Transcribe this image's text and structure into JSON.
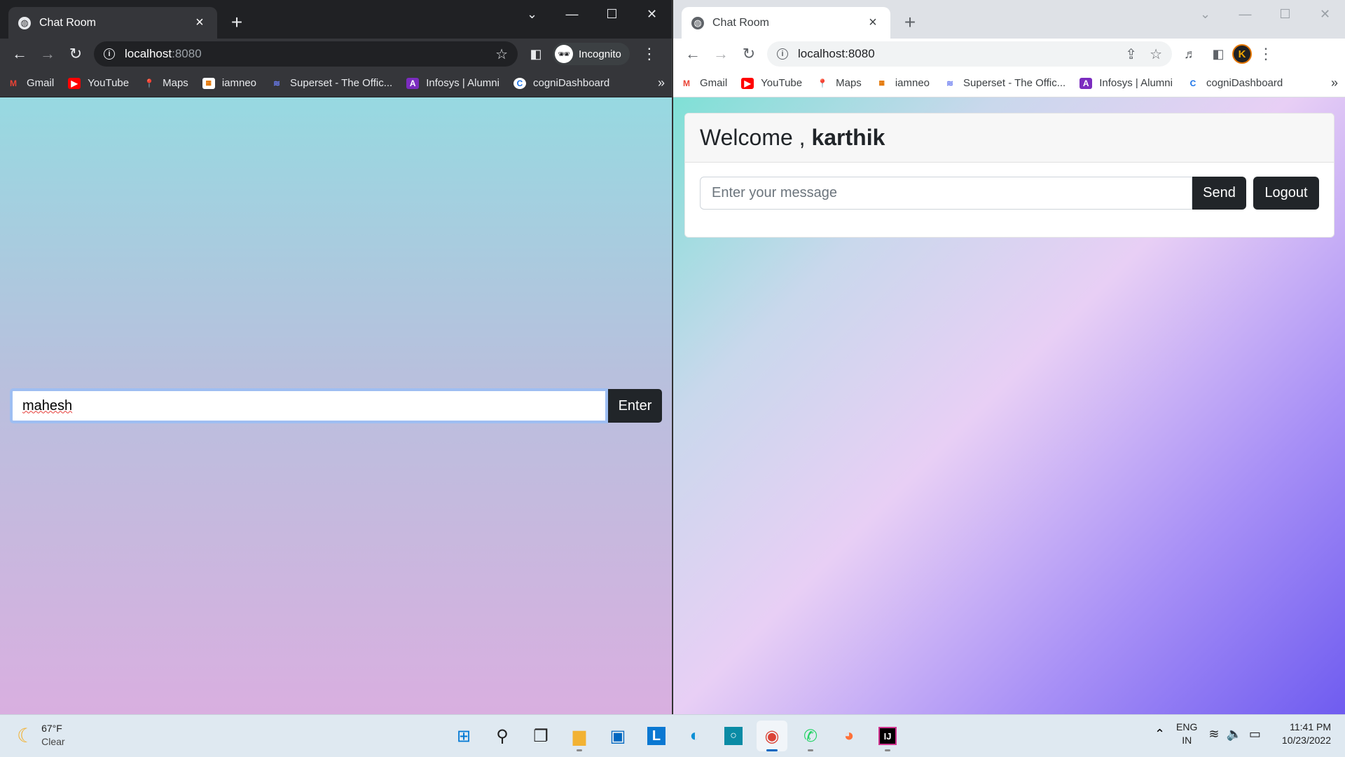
{
  "tab_title": "Chat Room",
  "address": {
    "host": "localhost",
    "port": ":8080"
  },
  "incognito_label": "Incognito",
  "profile_initial": "K",
  "bookmarks": [
    {
      "label": "Gmail",
      "icon": "gmail-icon"
    },
    {
      "label": "YouTube",
      "icon": "youtube-icon"
    },
    {
      "label": "Maps",
      "icon": "maps-icon"
    },
    {
      "label": "iamneo",
      "icon": "iamneo-icon"
    },
    {
      "label": "Superset - The Offic...",
      "icon": "superset-icon"
    },
    {
      "label": "Infosys | Alumni",
      "icon": "infosys-icon"
    },
    {
      "label": "cogniDashboard",
      "icon": "cognidashboard-icon"
    }
  ],
  "login": {
    "name_value": "mahesh",
    "enter_label": "Enter"
  },
  "chat": {
    "welcome_prefix": "Welcome ,",
    "username": "karthik",
    "message_placeholder": "Enter your message",
    "send_label": "Send",
    "logout_label": "Logout"
  },
  "taskbar": {
    "temperature": "67°F",
    "condition": "Clear",
    "lang_top": "ENG",
    "lang_bottom": "IN",
    "time": "11:41 PM",
    "date": "10/23/2022",
    "apps": [
      "start-icon",
      "search-icon",
      "task-view-icon",
      "file-explorer-icon",
      "store-icon",
      "l-app-icon",
      "edge-icon",
      "cortana-icon",
      "chrome-icon",
      "whatsapp-icon",
      "firefox-icon",
      "intellij-icon"
    ]
  },
  "colors": {
    "button_dark": "#212529",
    "accent_focus": "#9ebef2"
  }
}
